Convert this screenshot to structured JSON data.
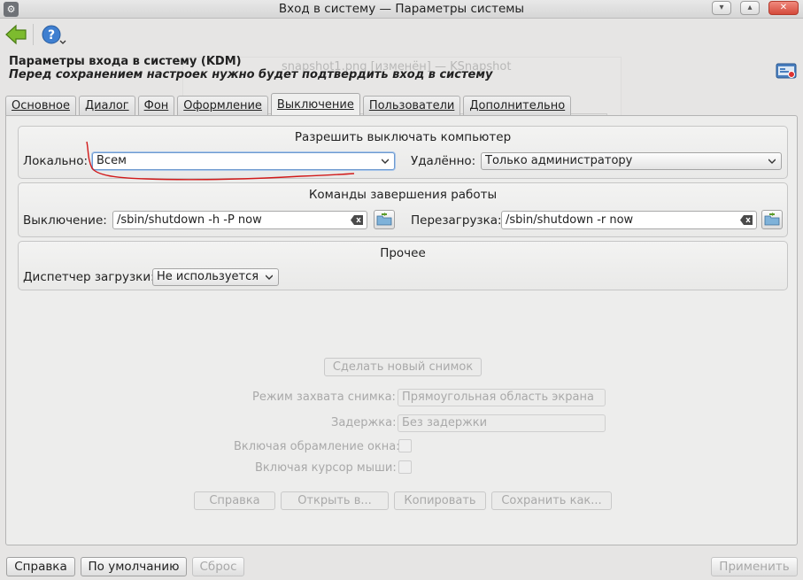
{
  "window": {
    "title": "Вход в систему — Параметры системы",
    "minimize_glyph": "▾",
    "maximize_glyph": "▴",
    "close_glyph": "✕"
  },
  "toolbar": {
    "back_icon": "back-arrow-icon",
    "help_icon": "help-icon"
  },
  "header": {
    "title": "Параметры входа в систему (KDM)",
    "note": "Перед сохранением настроек нужно будет подтвердить вход в систему"
  },
  "tabs": [
    {
      "label": "Основное"
    },
    {
      "label": "Диалог"
    },
    {
      "label": "Фон"
    },
    {
      "label": "Оформление"
    },
    {
      "label": "Выключение",
      "active": true
    },
    {
      "label": "Пользователи"
    },
    {
      "label": "Дополнительно"
    }
  ],
  "shutdown_group": {
    "title": "Разрешить выключать компьютер",
    "local_label": "Локально:",
    "local_value": "Всем",
    "remote_label": "Удалённо:",
    "remote_value": "Только администратору"
  },
  "commands_group": {
    "title": "Команды завершения работы",
    "halt_label": "Выключение:",
    "halt_value": "/sbin/shutdown -h -P now",
    "reboot_label": "Перезагрузка:",
    "reboot_value": "/sbin/shutdown -r now"
  },
  "misc_group": {
    "title": "Прочее",
    "bootmanager_label": "Диспетчер загрузки:",
    "bootmanager_value": "Не используется"
  },
  "ghost": {
    "title": "snapshot1.png [изменён] — KSnapshot",
    "new_snapshot": "Сделать новый снимок",
    "mode_label": "Режим захвата снимка:",
    "mode_value": "Прямоугольная область экрана",
    "delay_label": "Задержка:",
    "delay_value": "Без задержки",
    "decorations_label": "Включая обрамление окна:",
    "pointer_label": "Включая курсор мыши:",
    "help": "Справка",
    "open_with": "Открыть в...",
    "copy": "Копировать",
    "save_as": "Сохранить как..."
  },
  "bottom": {
    "help": "Справка",
    "defaults": "По умолчанию",
    "reset": "Сброс",
    "apply": "Применить"
  },
  "colors": {
    "annotation": "#d11a1a",
    "focus": "#6e9ad0"
  }
}
